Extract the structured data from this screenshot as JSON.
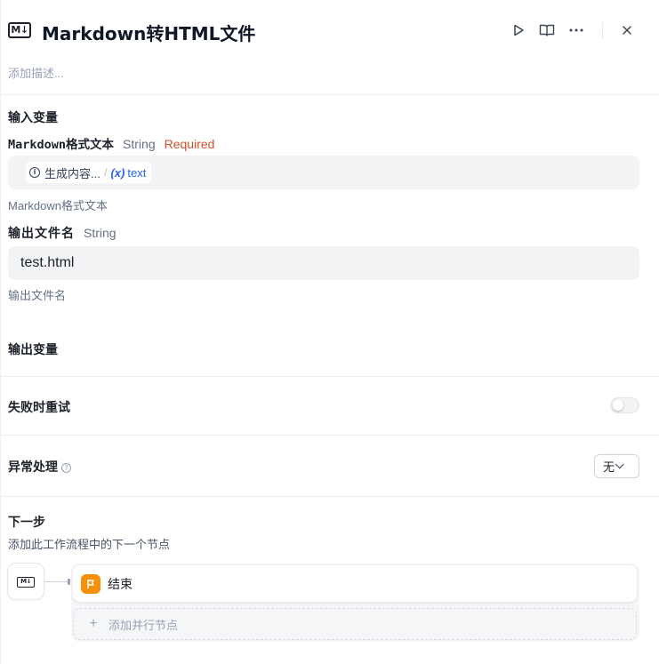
{
  "header": {
    "node_icon": "M↓",
    "title": "Markdown转HTML文件",
    "icons": [
      "play-icon",
      "book-icon",
      "more-icon",
      "close-icon"
    ]
  },
  "description_placeholder": "添加描述...",
  "input_section": {
    "title": "输入变量",
    "vars": [
      {
        "name": "Markdown格式文本",
        "type": "String",
        "required": "Required",
        "ref_source": "生成内容...",
        "ref_prefix": "(x)",
        "ref_var": "text",
        "hint": "Markdown格式文本"
      },
      {
        "name": "输出文件名",
        "type": "String",
        "value": "test.html",
        "hint": "输出文件名"
      }
    ]
  },
  "output_section": {
    "title": "输出变量"
  },
  "retry": {
    "title": "失败时重试",
    "enabled": false
  },
  "error_handling": {
    "title": "异常处理",
    "help": "?",
    "selected": "无"
  },
  "next_step": {
    "title": "下一步",
    "subtitle": "添加此工作流程中的下一个节点",
    "source_icon": "M↓",
    "node_label": "结束",
    "add_parallel": "添加并行节点",
    "add_symbol": "+"
  },
  "colors": {
    "required": "#d4502a",
    "var_ref": "#2563eb",
    "end_node": "#f79009",
    "input_bg": "#f2f3f5"
  }
}
